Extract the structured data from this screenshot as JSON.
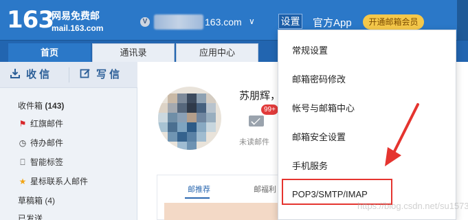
{
  "header": {
    "logo_number": "163",
    "logo_cn": "网易免费邮",
    "logo_url": "mail.163.com",
    "vip_badge": "V",
    "account_suffix": "163.com",
    "account_caret": "∨",
    "settings_label": "设置",
    "app_label": "官方App",
    "vip_button": "开通邮箱会员"
  },
  "tabs": [
    {
      "label": "首页",
      "active": true
    },
    {
      "label": "通讯录",
      "active": false
    },
    {
      "label": "应用中心",
      "active": false
    }
  ],
  "sidebar": {
    "receive_label": "收 信",
    "write_label": "写 信",
    "items": [
      {
        "label": "收件箱",
        "count": "(143)",
        "icon": ""
      },
      {
        "label": "红旗邮件",
        "count": "",
        "icon": "red-flag-icon"
      },
      {
        "label": "待办邮件",
        "count": "",
        "icon": "clock-icon"
      },
      {
        "label": "智能标签",
        "count": "",
        "icon": "bookmark-icon"
      },
      {
        "label": "星标联系人邮件",
        "count": "",
        "icon": "star-icon"
      },
      {
        "label": "草稿箱",
        "count": "(4)",
        "icon": ""
      },
      {
        "label": "已发送",
        "count": "",
        "icon": ""
      }
    ]
  },
  "main": {
    "username": "苏朋辉，",
    "unread_badge": "99+",
    "unread_label": "未读邮件",
    "subtab_recommend": "邮推荐",
    "subtab_benefit": "邮福利"
  },
  "dropdown": {
    "items": [
      "常规设置",
      "邮箱密码修改",
      "帐号与邮箱中心",
      "邮箱安全设置",
      "手机服务",
      "POP3/SMTP/IMAP"
    ],
    "highlighted": "POP3/SMTP/IMAP"
  },
  "watermark": "https://blog.csdn.net/su1573",
  "colors": {
    "brand_blue": "#2b78c8",
    "highlight_red": "#e5342f",
    "vip_yellow": "#f5c84a",
    "badge_red": "#e23b3b"
  }
}
